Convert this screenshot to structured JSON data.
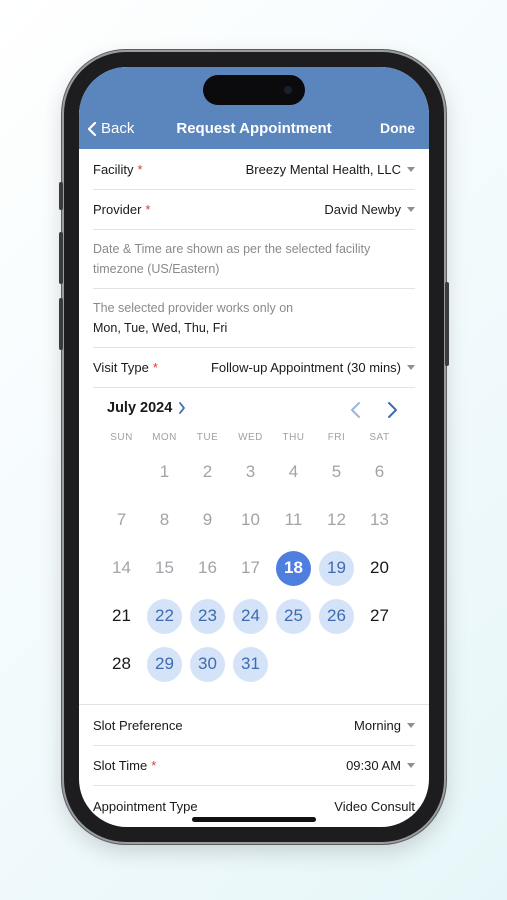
{
  "nav": {
    "back_label": "Back",
    "title": "Request Appointment",
    "done_label": "Done"
  },
  "form": {
    "facility": {
      "label": "Facility",
      "required": "*",
      "value": "Breezy Mental Health, LLC"
    },
    "provider": {
      "label": "Provider",
      "required": "*",
      "value": "David Newby"
    },
    "timezone_note": "Date & Time are shown as per the selected facility timezone (US/Eastern)",
    "provider_days_note": "The selected provider works only on",
    "provider_days": "Mon, Tue, Wed, Thu, Fri",
    "visit_type": {
      "label": "Visit Type",
      "required": "*",
      "value": "Follow-up Appointment (30 mins)"
    },
    "slot_preference": {
      "label": "Slot Preference",
      "value": "Morning"
    },
    "slot_time": {
      "label": "Slot Time",
      "required": "*",
      "value": "09:30 AM"
    },
    "appointment_type": {
      "label": "Appointment Type",
      "value": "Video Consult"
    }
  },
  "calendar": {
    "month_label": "July 2024",
    "weekdays": [
      "SUN",
      "MON",
      "TUE",
      "WED",
      "THU",
      "FRI",
      "SAT"
    ],
    "weeks": [
      [
        {
          "d": ""
        },
        {
          "d": "1",
          "s": "past"
        },
        {
          "d": "2",
          "s": "past"
        },
        {
          "d": "3",
          "s": "past"
        },
        {
          "d": "4",
          "s": "past"
        },
        {
          "d": "5",
          "s": "past"
        },
        {
          "d": "6",
          "s": "past"
        }
      ],
      [
        {
          "d": "7",
          "s": "past"
        },
        {
          "d": "8",
          "s": "past"
        },
        {
          "d": "9",
          "s": "past"
        },
        {
          "d": "10",
          "s": "past"
        },
        {
          "d": "11",
          "s": "past"
        },
        {
          "d": "12",
          "s": "past"
        },
        {
          "d": "13",
          "s": "past"
        }
      ],
      [
        {
          "d": "14",
          "s": "past"
        },
        {
          "d": "15",
          "s": "past"
        },
        {
          "d": "16",
          "s": "past"
        },
        {
          "d": "17",
          "s": "past"
        },
        {
          "d": "18",
          "s": "sel"
        },
        {
          "d": "19",
          "s": "avail"
        },
        {
          "d": "20",
          "s": "norm"
        }
      ],
      [
        {
          "d": "21",
          "s": "norm"
        },
        {
          "d": "22",
          "s": "avail"
        },
        {
          "d": "23",
          "s": "avail"
        },
        {
          "d": "24",
          "s": "avail"
        },
        {
          "d": "25",
          "s": "avail"
        },
        {
          "d": "26",
          "s": "avail"
        },
        {
          "d": "27",
          "s": "norm"
        }
      ],
      [
        {
          "d": "28",
          "s": "norm"
        },
        {
          "d": "29",
          "s": "avail"
        },
        {
          "d": "30",
          "s": "avail"
        },
        {
          "d": "31",
          "s": "avail"
        },
        {
          "d": ""
        },
        {
          "d": ""
        },
        {
          "d": ""
        }
      ]
    ]
  },
  "colors": {
    "nav_bg": "#5b86bd",
    "selected": "#4e7fe0",
    "available": "#d4e3f7",
    "required": "#d93a3a"
  }
}
